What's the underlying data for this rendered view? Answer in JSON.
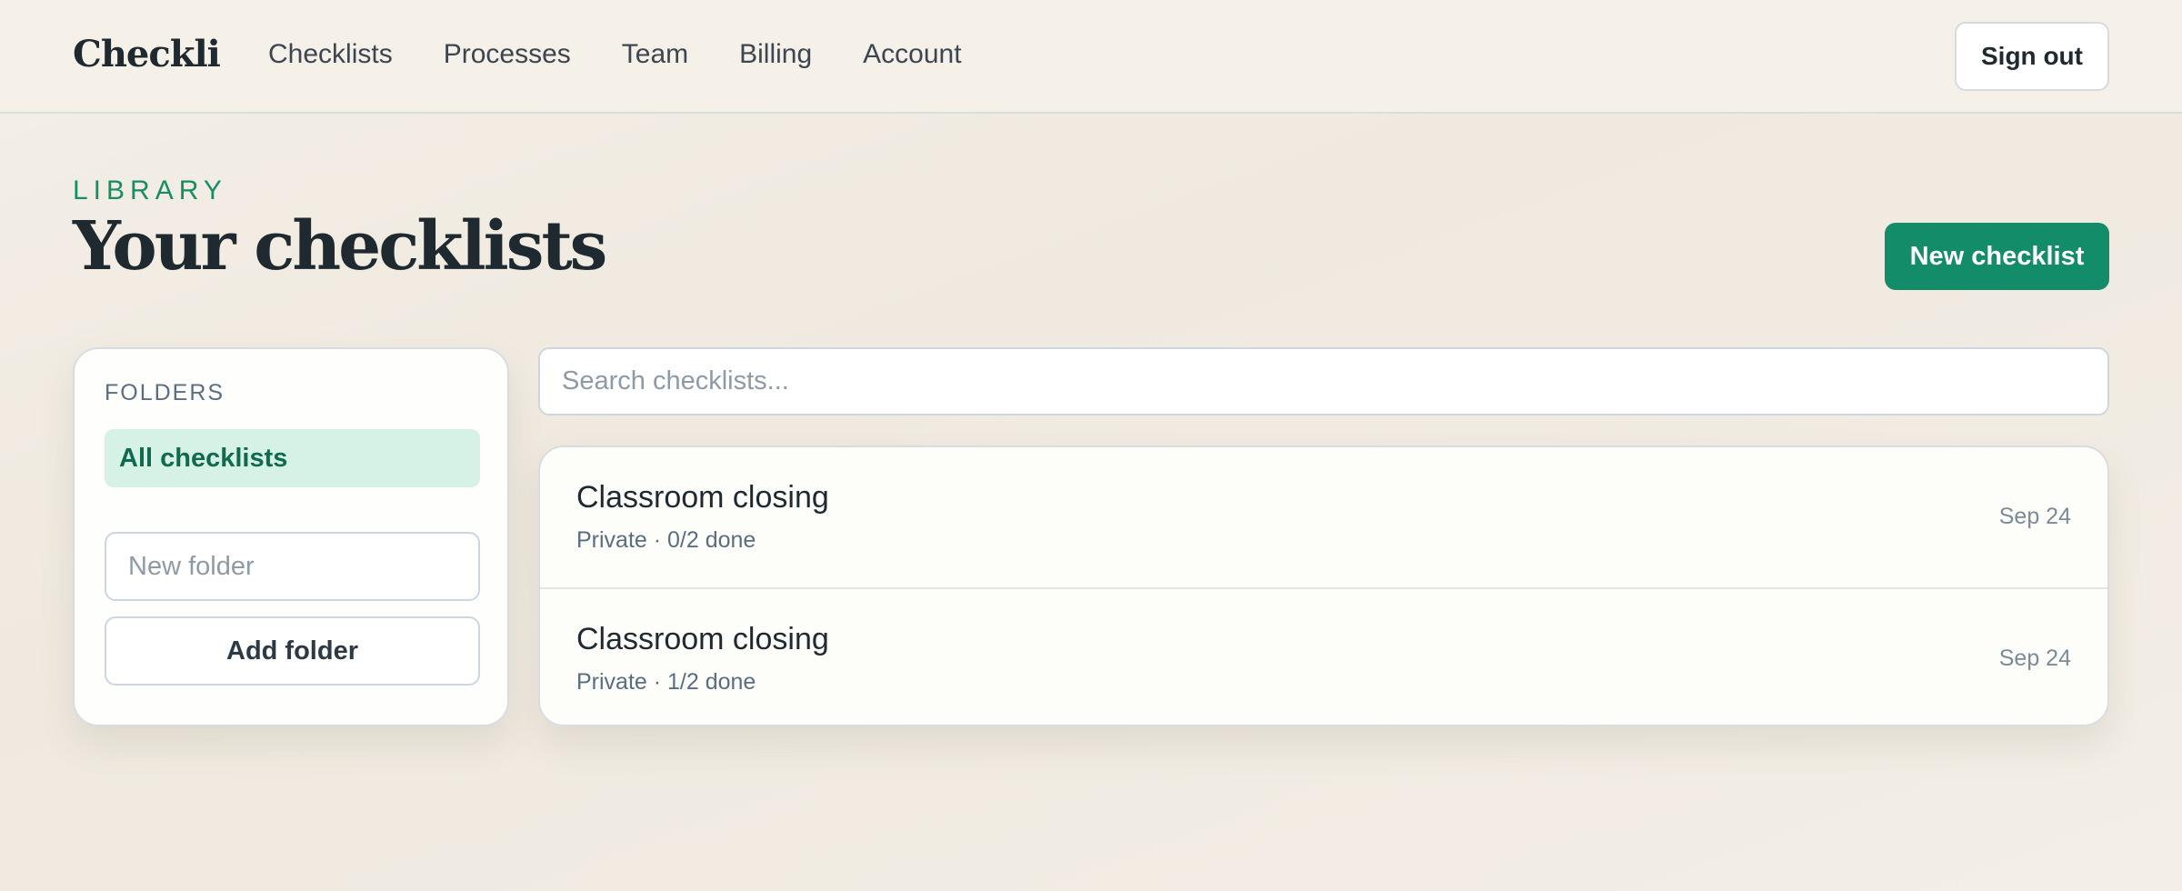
{
  "app": {
    "logo": "Checkli"
  },
  "nav": {
    "items": [
      {
        "label": "Checklists"
      },
      {
        "label": "Processes"
      },
      {
        "label": "Team"
      },
      {
        "label": "Billing"
      },
      {
        "label": "Account"
      }
    ],
    "sign_out": "Sign out"
  },
  "header": {
    "eyebrow": "LIBRARY",
    "title": "Your checklists",
    "new_button": "New checklist"
  },
  "folders": {
    "heading": "FOLDERS",
    "active": "All checklists",
    "new_folder_placeholder": "New folder",
    "add_button": "Add folder"
  },
  "search": {
    "placeholder": "Search checklists..."
  },
  "checklists": [
    {
      "title": "Classroom closing",
      "meta": "Private · 0/2 done",
      "date": "Sep 24"
    },
    {
      "title": "Classroom closing",
      "meta": "Private · 1/2 done",
      "date": "Sep 24"
    }
  ],
  "colors": {
    "accent": "#138c6a",
    "accent_light": "#d6f2e7",
    "text": "#1f2a30",
    "muted": "#5a6e80",
    "background": "#f4efe7"
  }
}
